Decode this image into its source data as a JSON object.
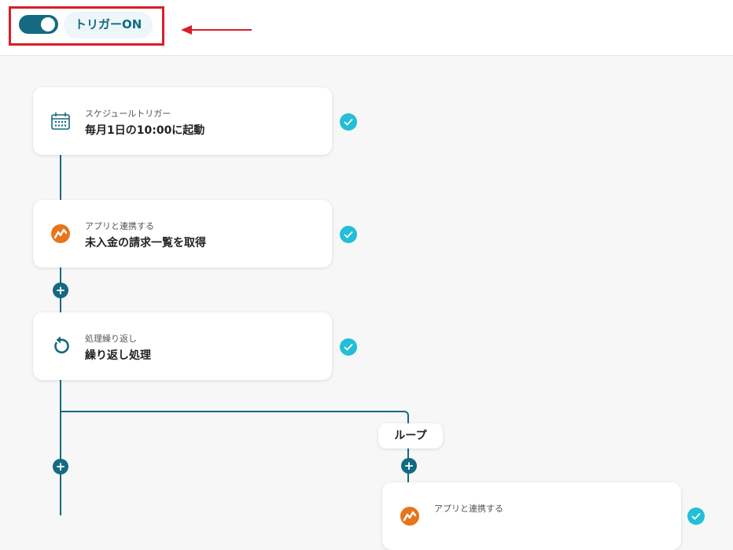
{
  "header": {
    "trigger_label": "トリガーON",
    "trigger_on": true
  },
  "flow": {
    "steps": [
      {
        "subtitle": "スケジュールトリガー",
        "title": "毎月1日の10:00に起動",
        "icon": "calendar-schedule-icon",
        "status": "complete"
      },
      {
        "subtitle": "アプリと連携する",
        "title": "未入金の請求一覧を取得",
        "icon": "money-forward-app-icon",
        "status": "complete"
      },
      {
        "subtitle": "処理繰り返し",
        "title": "繰り返し処理",
        "icon": "repeat-icon",
        "status": "complete"
      },
      {
        "subtitle": "アプリと連携する",
        "title": "",
        "icon": "money-forward-app-icon",
        "status": "complete"
      }
    ],
    "loop_label": "ループ"
  },
  "colors": {
    "primary": "#136a82",
    "check": "#22bfd6",
    "highlight": "#d81e2a",
    "app_orange": "#e8751a"
  }
}
